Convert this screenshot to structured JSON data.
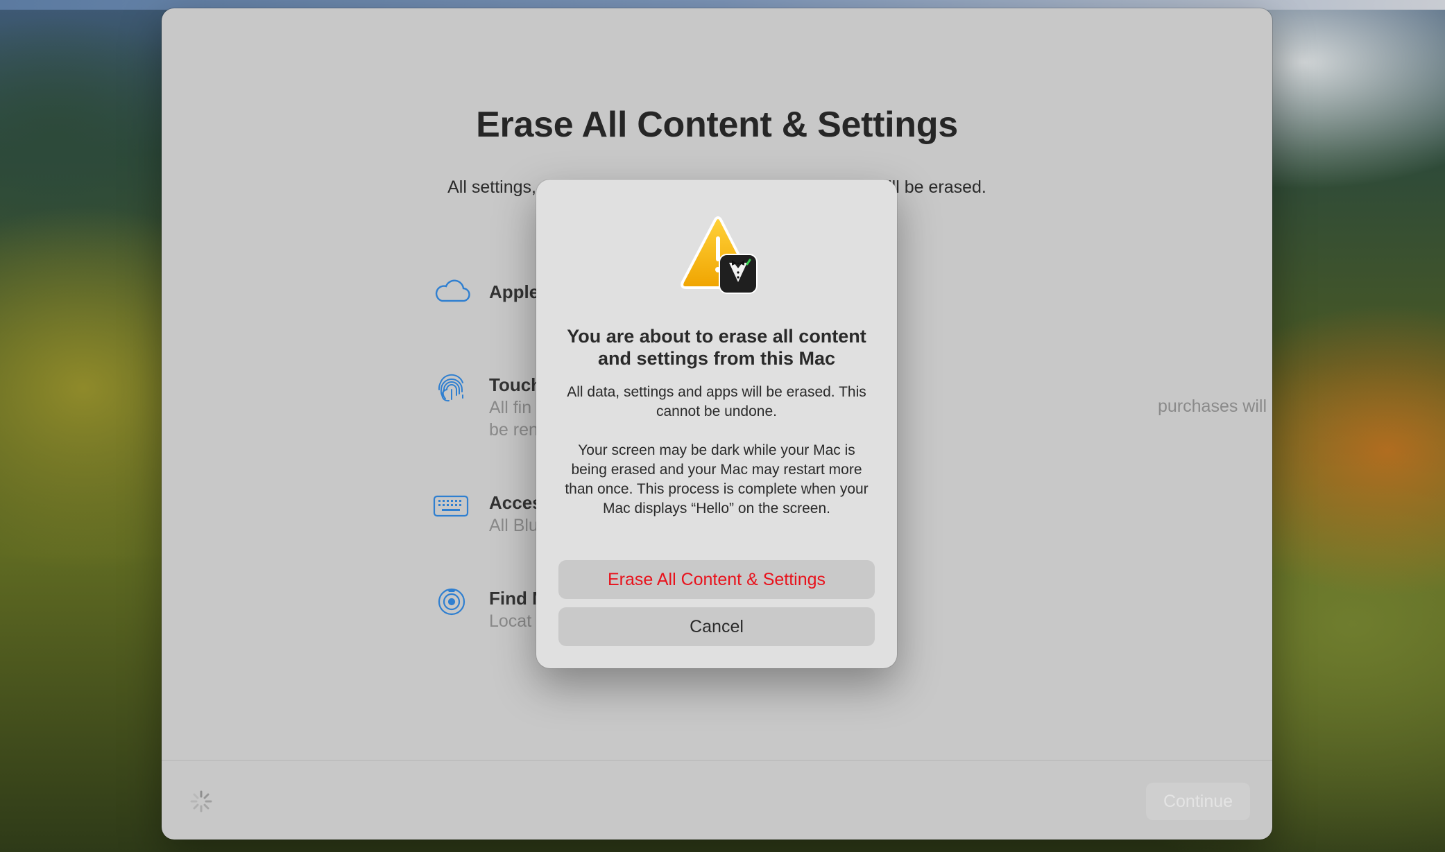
{
  "window": {
    "title": "Erase All Content & Settings",
    "subtitle": "All settings, media and data for all volumes on this Mac will be erased."
  },
  "items": [
    {
      "icon": "cloud-icon",
      "title": "Apple",
      "description": "",
      "description_right": ""
    },
    {
      "icon": "fingerprint-icon",
      "title": "Touch",
      "description": "All fin\nbe ren",
      "description_right": "purchases will"
    },
    {
      "icon": "keyboard-icon",
      "title": "Acces",
      "description": "All Blu",
      "description_right": ""
    },
    {
      "icon": "find-my-icon",
      "title": "Find M",
      "description": "Locat",
      "description_right": ""
    }
  ],
  "footer": {
    "continue_label": "Continue"
  },
  "dialog": {
    "icon": "warning-butler-icon",
    "title": "You are about to erase all content and settings from this Mac",
    "body_1": "All data, settings and apps will be erased. This cannot be undone.",
    "body_2": "Your screen may be dark while your Mac is being erased and your Mac may restart more than once. This process is complete when your Mac displays “Hello” on the screen.",
    "erase_label": "Erase All Content & Settings",
    "cancel_label": "Cancel"
  },
  "colors": {
    "accent_icon": "#2f7fd0",
    "destructive": "#e8121c"
  }
}
